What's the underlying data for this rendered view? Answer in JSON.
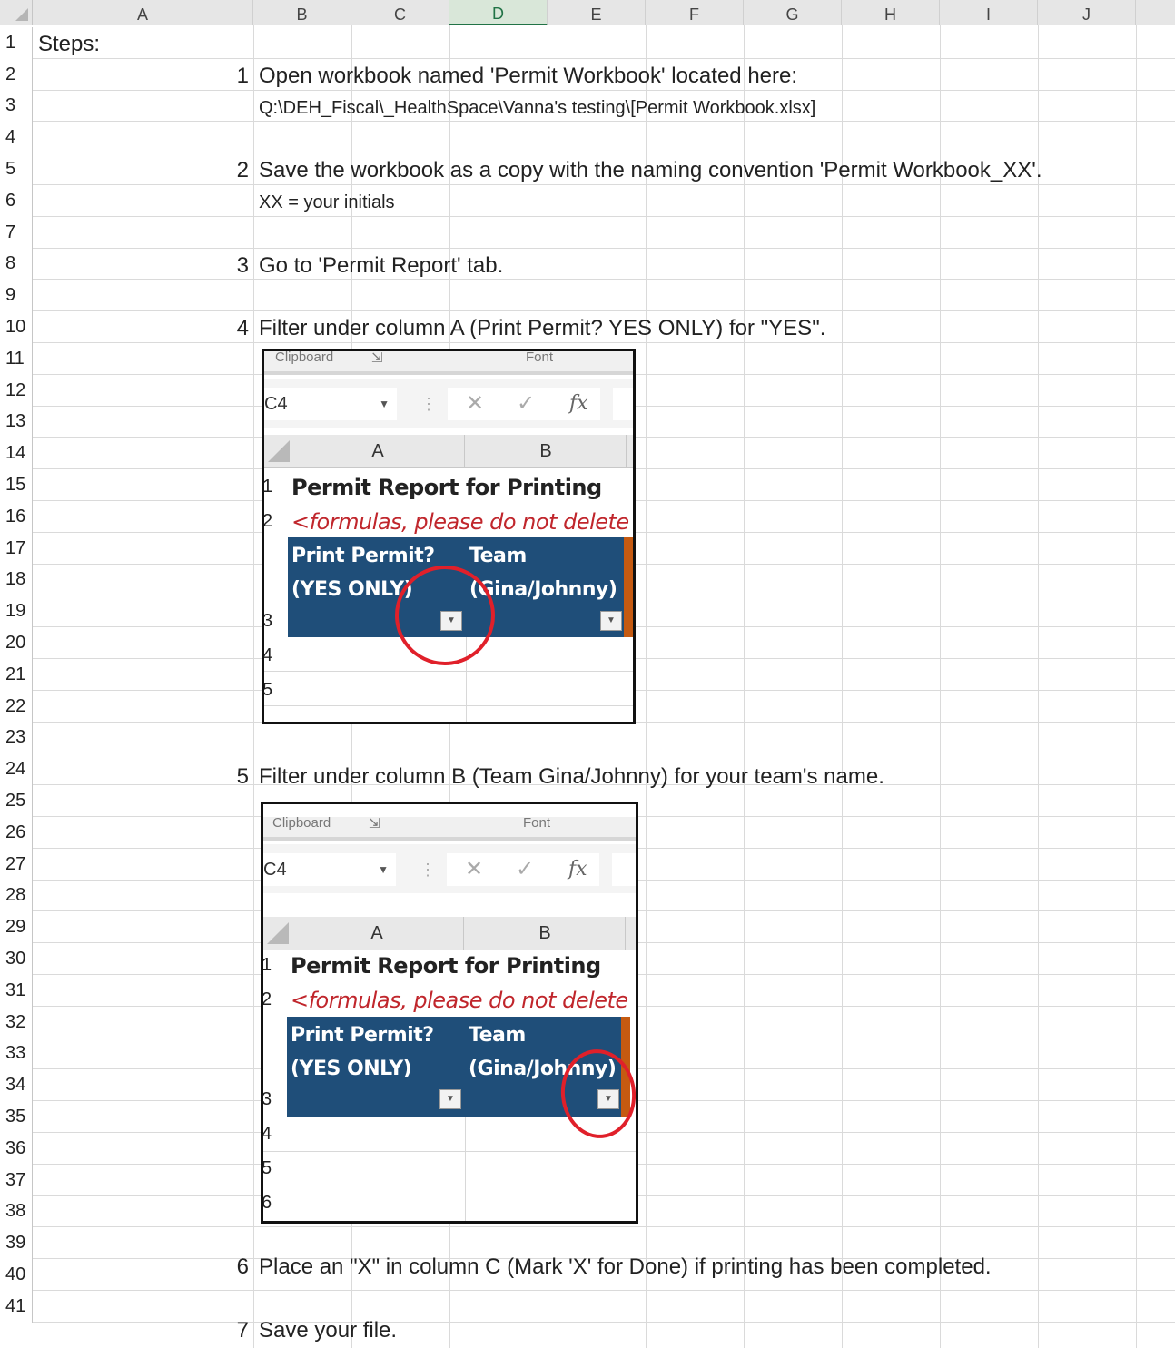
{
  "columns": [
    "A",
    "B",
    "C",
    "D",
    "E",
    "F",
    "G",
    "H",
    "I",
    "J"
  ],
  "rows": [
    "1",
    "2",
    "3",
    "4",
    "5",
    "6",
    "7",
    "8",
    "9",
    "10",
    "11",
    "12",
    "13",
    "14",
    "15",
    "16",
    "17",
    "18",
    "19",
    "20",
    "21",
    "22",
    "23",
    "24",
    "25",
    "26",
    "27",
    "28",
    "29",
    "30",
    "31",
    "32",
    "33",
    "34",
    "35",
    "36",
    "37",
    "38",
    "39",
    "40",
    "41"
  ],
  "cells": {
    "steps_label": "Steps:",
    "step1_num": "1",
    "step1_text": "Open workbook named 'Permit Workbook' located here:",
    "step1_path": "Q:\\DEH_Fiscal\\_HealthSpace\\Vanna's testing\\[Permit Workbook.xlsx]",
    "step2_num": "2",
    "step2_text": "Save the workbook as a copy with the naming convention 'Permit Workbook_XX'.",
    "step2_note": "XX = your initials",
    "step3_num": "3",
    "step3_text": "Go to 'Permit Report' tab.",
    "step4_num": "4",
    "step4_text": "Filter under column A (Print Permit? YES ONLY) for \"YES\".",
    "step5_num": "5",
    "step5_text": "Filter under column B (Team Gina/Johnny) for your team's name.",
    "step6_num": "6",
    "step6_text": "Place an \"X\" in column C (Mark 'X' for Done) if printing has been completed.",
    "step7_num": "7",
    "step7_text": "Save your file."
  },
  "screenshot": {
    "ribbon_clipboard": "Clipboard",
    "ribbon_launcher": "⇲",
    "ribbon_font": "Font",
    "name_box": "C4",
    "cancel_icon": "✕",
    "enter_icon": "✓",
    "fx_label": "fx",
    "col_a": "A",
    "col_b": "B",
    "title": "Permit Report for Printing",
    "subtitle": "<formulas, please do not delete col",
    "header_a_line1": "Print Permit?",
    "header_a_line2": "(YES ONLY)",
    "header_b_line1": "Team",
    "header_b_line2": "(Gina/Johnny)",
    "row_nums_1": [
      "1",
      "2",
      "3",
      "4",
      "5"
    ],
    "row_nums_2": [
      "1",
      "2",
      "3",
      "4",
      "5",
      "6"
    ]
  },
  "colors": {
    "header_blue": "#1f4e79",
    "annotation_red": "#e0202a",
    "accent_green": "#217346"
  }
}
